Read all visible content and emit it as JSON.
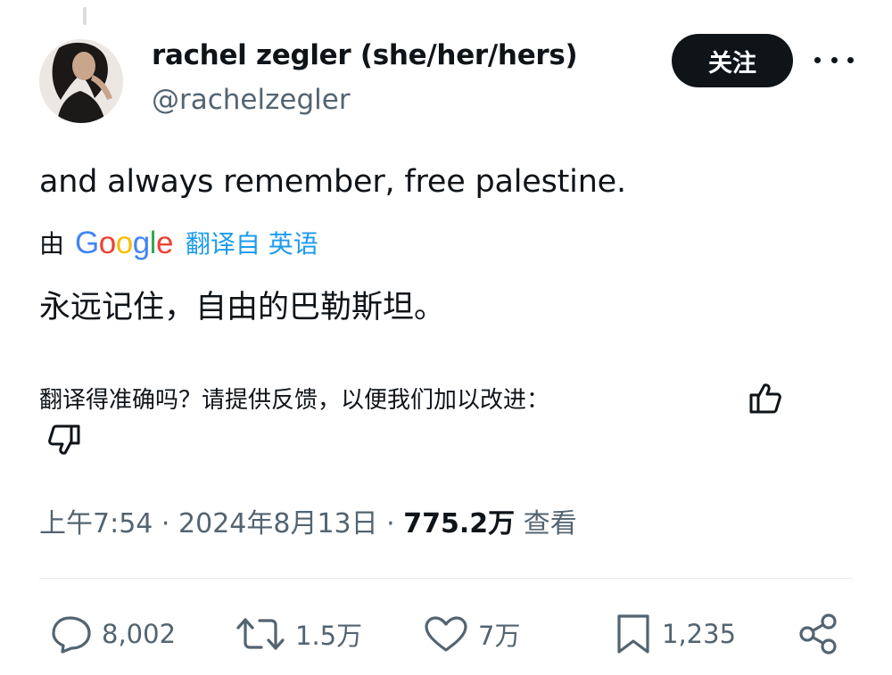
{
  "author": {
    "name": "rachel zegler (she/her/hers)",
    "handle": "@rachelzegler"
  },
  "follow_label": "关注",
  "tweet": {
    "text": "and always remember, free palestine."
  },
  "translation": {
    "by_label": "由",
    "google_logo": "Google",
    "translated_from": "翻译自 英语",
    "text": "永远记住，自由的巴勒斯坦。"
  },
  "feedback": {
    "prompt": "翻译得准确吗？请提供反馈，以便我们加以改进："
  },
  "meta": {
    "time": "上午7:54",
    "date": "2024年8月13日",
    "views_count": "775.2万",
    "views_label": "查看"
  },
  "actions": {
    "replies": "8,002",
    "reposts": "1.5万",
    "likes": "7万",
    "bookmarks": "1,235"
  },
  "colors": {
    "link": "#1d9bf0",
    "secondary_text": "#536471",
    "primary_text": "#0f1419"
  },
  "icons": [
    "more-icon",
    "thumbs-up-icon",
    "thumbs-down-icon",
    "reply-icon",
    "repost-icon",
    "like-icon",
    "bookmark-icon",
    "share-icon"
  ]
}
